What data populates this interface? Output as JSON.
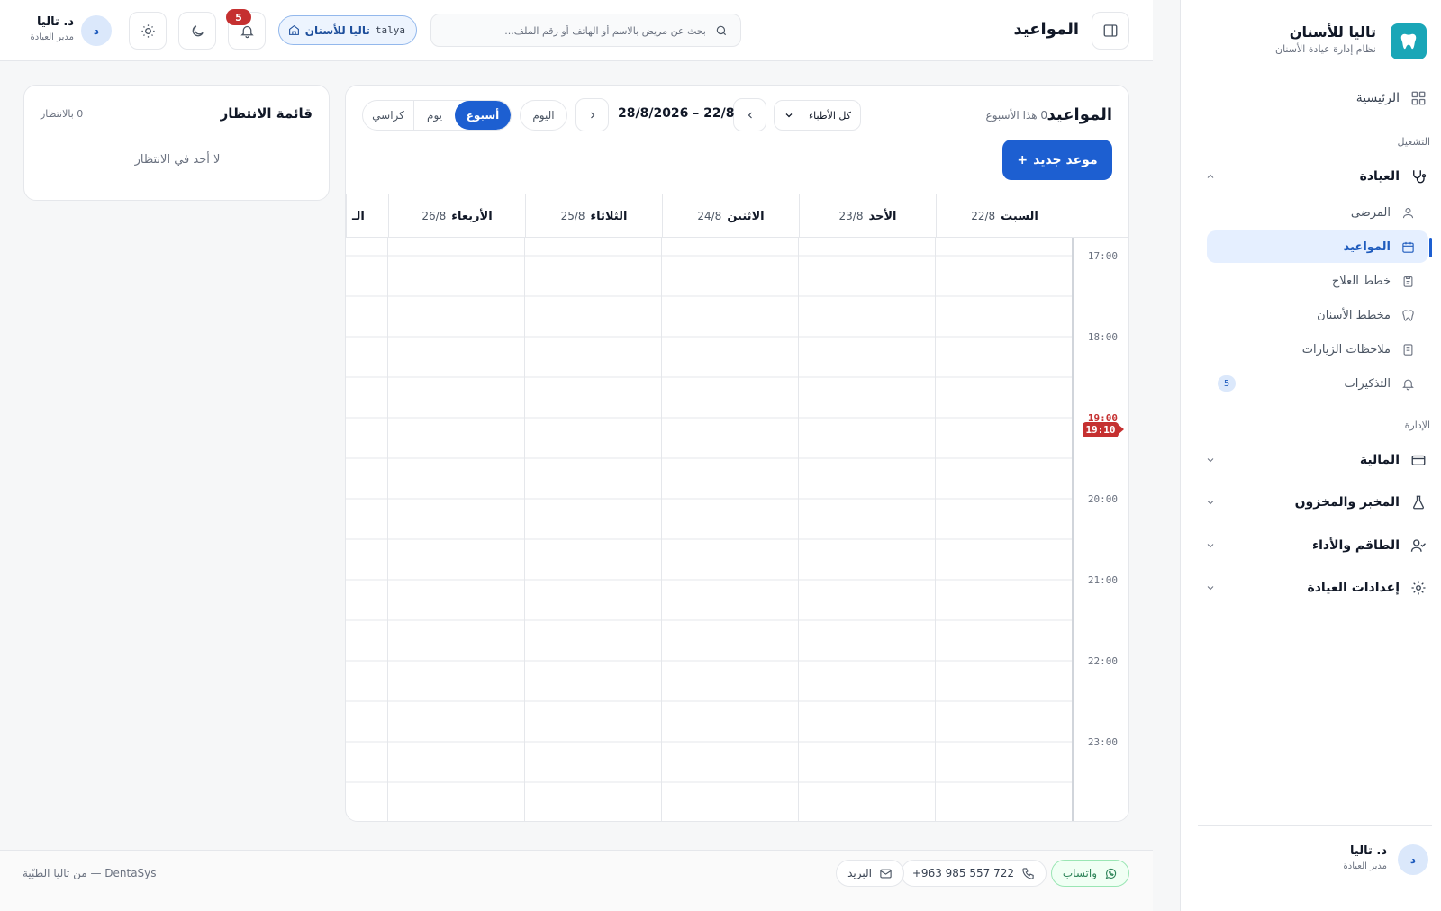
{
  "brand": {
    "name": "تاليا للأسنان",
    "subtitle": "نظام إدارة عيادة الأسنان"
  },
  "sidebar": {
    "home_label": "الرئيسية",
    "section_operation": "التشغيل",
    "clinic_group": {
      "label": "العيادة",
      "expanded": true
    },
    "clinic_items": [
      {
        "label": "المرضى",
        "icon": "user-icon"
      },
      {
        "label": "المواعيد",
        "icon": "calendar-icon",
        "active": true
      },
      {
        "label": "خطط العلاج",
        "icon": "clipboard-icon"
      },
      {
        "label": "مخطط الأسنان",
        "icon": "tooth-icon"
      },
      {
        "label": "ملاحظات الزيارات",
        "icon": "note-icon"
      },
      {
        "label": "التذكيرات",
        "icon": "bell-icon",
        "badge": "5"
      }
    ],
    "section_admin": "الإدارة",
    "admin_groups": [
      {
        "label": "المالية",
        "icon": "card-icon"
      },
      {
        "label": "المخبر والمخزون",
        "icon": "flask-icon"
      },
      {
        "label": "الطاقم والأداء",
        "icon": "staff-icon"
      },
      {
        "label": "إعدادات العيادة",
        "icon": "gear-icon"
      }
    ],
    "user": {
      "initial": "د",
      "name": "د. تاليا",
      "role": "مدير العيادة"
    }
  },
  "topbar": {
    "title": "المواعيد",
    "search_placeholder": "بحث عن مريض بالاسم أو الهاتف أو رقم الملف...",
    "clinic_name": "تاليا للأسنان",
    "clinic_slug": "talya",
    "notifications_count": "5",
    "user": {
      "initial": "د",
      "name": "د. تاليا",
      "role": "مدير العيادة"
    }
  },
  "calendar": {
    "title": "المواعيد",
    "week_count": "0 هذا الأسبوع",
    "new_button": "موعد جديد",
    "new_button_icon": "+",
    "doctor_filter": "كل الأطباء",
    "range": "28/8/2026 – 22/8",
    "today_label": "اليوم",
    "views": [
      "أسبوع",
      "يوم",
      "كراسي"
    ],
    "active_view": "أسبوع",
    "days": [
      {
        "name": "السبت",
        "date": "22/8"
      },
      {
        "name": "الأحد",
        "date": "23/8"
      },
      {
        "name": "الاثنين",
        "date": "24/8"
      },
      {
        "name": "الثلاثاء",
        "date": "25/8"
      },
      {
        "name": "الأربعاء",
        "date": "26/8"
      },
      {
        "name": "الـ",
        "date": ""
      }
    ],
    "hours": [
      "17:00",
      "18:00",
      "19:00",
      "20:00",
      "21:00",
      "22:00",
      "23:00"
    ],
    "now_time": "19:10",
    "now_color": "#c53030"
  },
  "waitlist": {
    "title": "قائمة الانتظار",
    "count": "0 بالانتظار",
    "empty": "لا أحد في الانتظار"
  },
  "footer": {
    "whatsapp": "واتساب",
    "phone": "+963 985 557 722",
    "email": "البريد",
    "credit": "DentaSys — من تاليا الطبّية"
  },
  "colors": {
    "accent": "#1d5fd1",
    "logo": "#1aa6b7",
    "danger": "#c53030"
  }
}
